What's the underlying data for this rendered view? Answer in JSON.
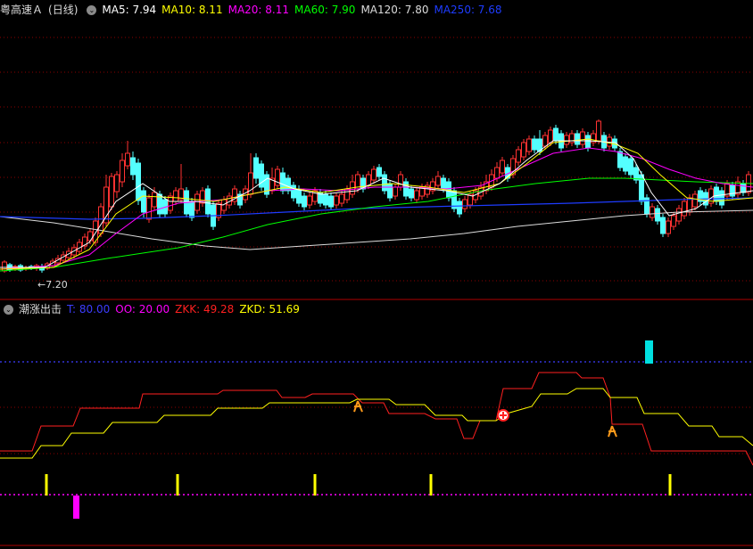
{
  "main_panel": {
    "stock_name": "粤高速Ａ",
    "period": "(日线)",
    "ma_items": [
      {
        "label": "MA5: 7.94",
        "color": "#ffffff"
      },
      {
        "label": "MA10: 8.11",
        "color": "#ffff00"
      },
      {
        "label": "MA20: 8.11",
        "color": "#ff00ff"
      },
      {
        "label": "MA60: 7.90",
        "color": "#00ff00"
      },
      {
        "label": "MA120: 7.80",
        "color": "#dcdcdc"
      },
      {
        "label": "MA250: 7.68",
        "color": "#1e3cff"
      }
    ],
    "low_price_label": "7.20"
  },
  "indicator_panel": {
    "name": "潮涨出击",
    "items": [
      {
        "label": "T: 80.00",
        "color": "#3c3cff"
      },
      {
        "label": "OO: 20.00",
        "color": "#ff00ff"
      },
      {
        "label": "ZKK: 49.28",
        "color": "#ff2020"
      },
      {
        "label": "ZKD: 51.69",
        "color": "#ffff00"
      }
    ]
  },
  "colors": {
    "up": "#ff3232",
    "down": "#54ffff",
    "grid": "#8b0000",
    "panel_border": "#b00000"
  },
  "icons": [
    "dropdown-control-icon",
    "buy-signal-icon",
    "sell-signal-icon"
  ]
}
